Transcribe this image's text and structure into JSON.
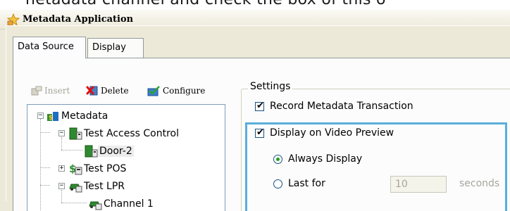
{
  "caption": "netadata channel and check the box of this o",
  "window": {
    "title": "Metadata Application"
  },
  "tabs": [
    {
      "label": "Data Source",
      "active": true
    },
    {
      "label": "Display",
      "active": false
    }
  ],
  "toolbar": {
    "insert_label": "Insert",
    "delete_label": "Delete",
    "configure_label": "Configure"
  },
  "tree": {
    "root": "Metadata",
    "access_control": "Test Access Control",
    "door": "Door-2",
    "pos": "Test POS",
    "lpr": "Test LPR",
    "channel": "Channel 1"
  },
  "settings": {
    "legend": "Settings",
    "record_label": "Record Metadata Transaction",
    "record_checked": true,
    "display_label": "Display on Video Preview",
    "display_checked": true,
    "always_label": "Always Display",
    "last_label": "Last for",
    "last_value": "10",
    "seconds_label": "seconds",
    "selected_mode": "Always Display"
  },
  "colors": {
    "highlight": "#5aaedc",
    "check_green": "#21a121",
    "window_bg": "#ece9d8"
  }
}
